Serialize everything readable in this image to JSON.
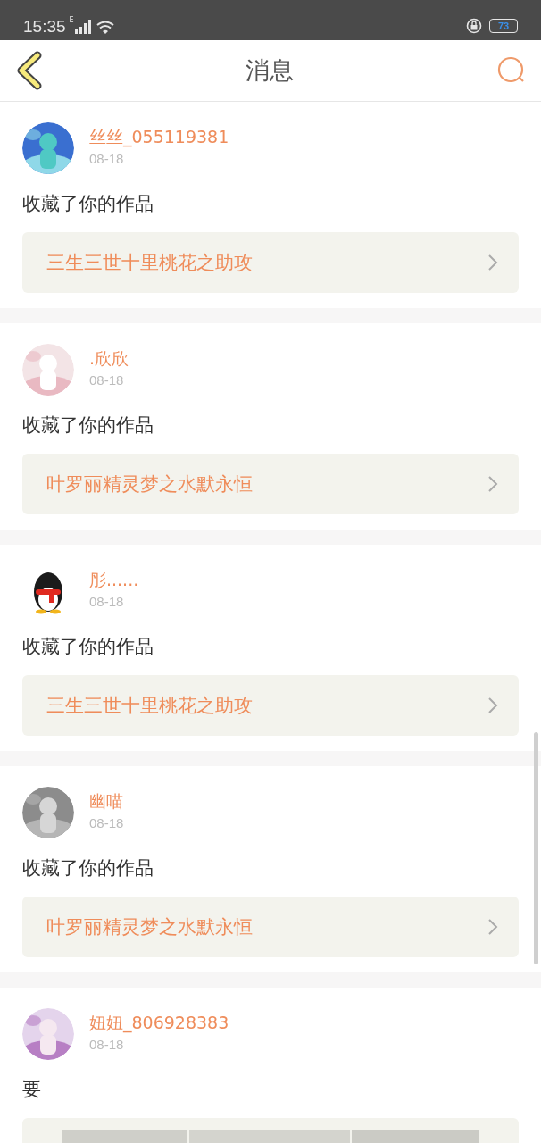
{
  "status_bar": {
    "time": "15:35",
    "network": "E",
    "battery": "73"
  },
  "header": {
    "title": "消息"
  },
  "messages": [
    {
      "user": "丝丝_055119381",
      "date": "08-18",
      "text": "收藏了你的作品",
      "work": {
        "kind": "title",
        "title": "三生三世十里桃花之助攻"
      }
    },
    {
      "user": ".欣欣",
      "date": "08-18",
      "text": "收藏了你的作品",
      "work": {
        "kind": "title",
        "title": "叶罗丽精灵梦之水默永恒"
      }
    },
    {
      "user": "彤......",
      "date": "08-18",
      "text": "收藏了你的作品",
      "work": {
        "kind": "title",
        "title": "三生三世十里桃花之助攻"
      }
    },
    {
      "user": "幽喵",
      "date": "08-18",
      "text": "收藏了你的作品",
      "work": {
        "kind": "title",
        "title": "叶罗丽精灵梦之水默永恒"
      }
    },
    {
      "user": "妞妞_806928383",
      "date": "08-18",
      "text": "要",
      "work": {
        "kind": "images"
      }
    }
  ]
}
